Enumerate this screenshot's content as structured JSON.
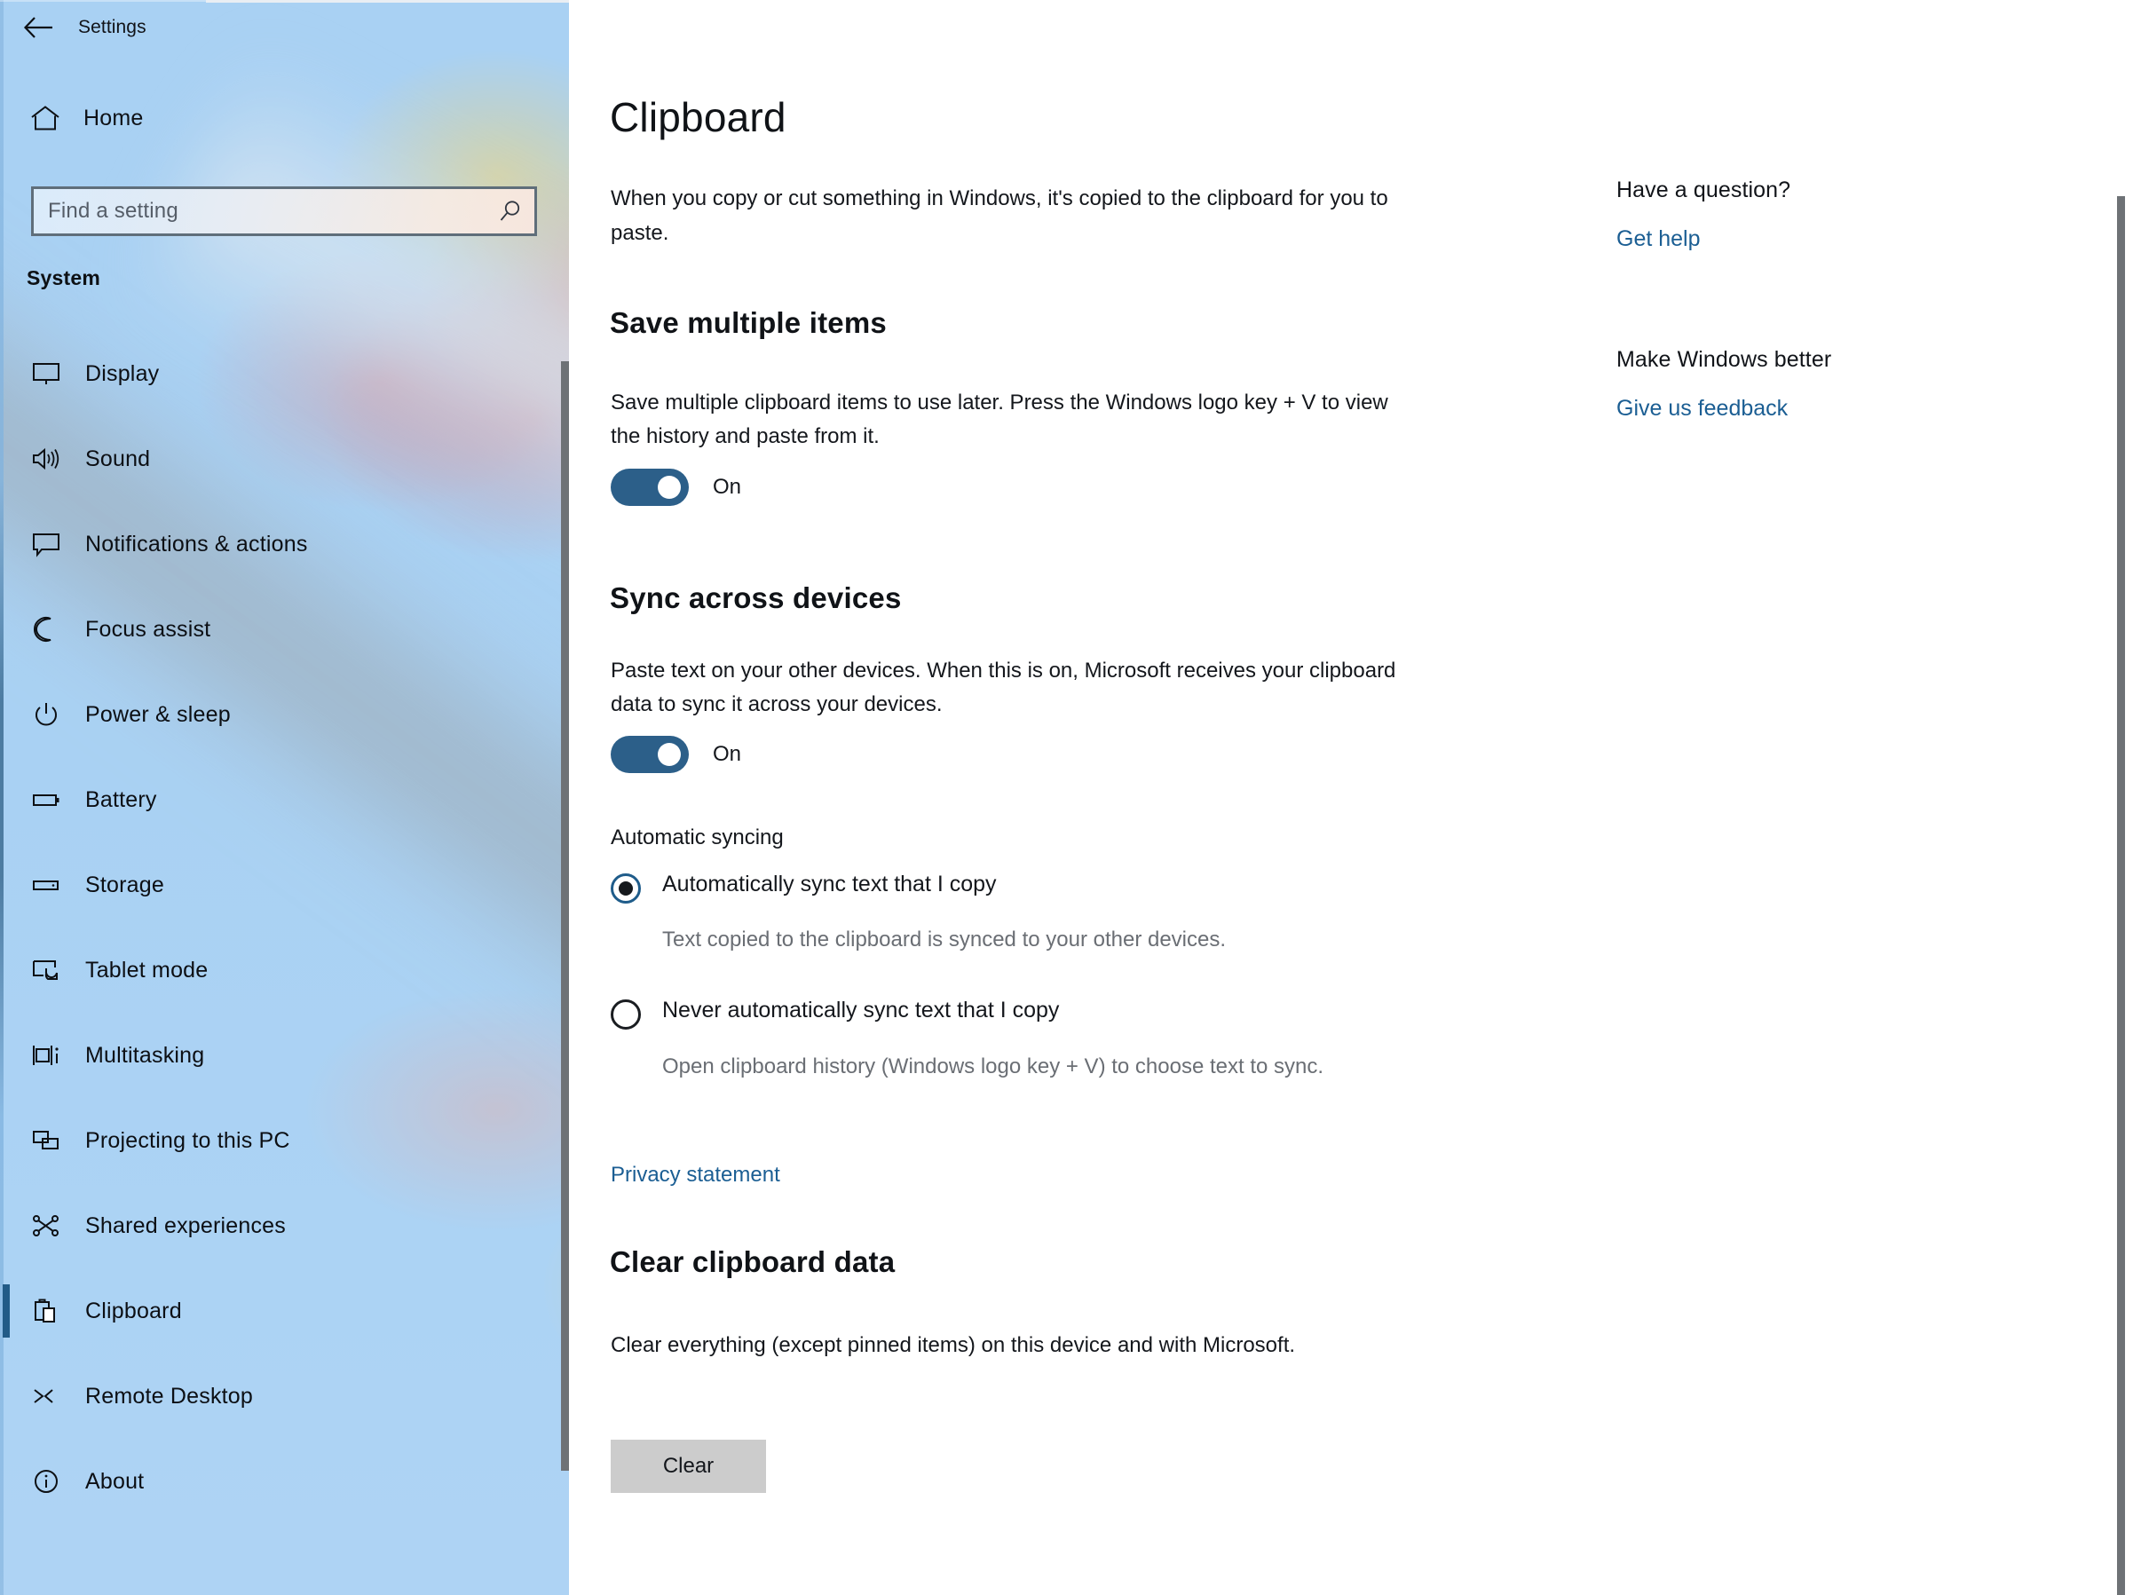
{
  "window": {
    "titlebar_back_icon": "back-arrow-icon",
    "app_title": "Settings"
  },
  "sidebar": {
    "home_label": "Home",
    "home_icon": "home-icon",
    "search": {
      "placeholder": "Find a setting",
      "value": "",
      "icon": "search-icon"
    },
    "section_label": "System",
    "selected_item": "Clipboard",
    "items": [
      {
        "label": "Display",
        "icon": "monitor-icon",
        "selected": false
      },
      {
        "label": "Sound",
        "icon": "speaker-icon",
        "selected": false
      },
      {
        "label": "Notifications & actions",
        "icon": "chat-bubble-icon",
        "selected": false
      },
      {
        "label": "Focus assist",
        "icon": "moon-icon",
        "selected": false
      },
      {
        "label": "Power & sleep",
        "icon": "power-icon",
        "selected": false
      },
      {
        "label": "Battery",
        "icon": "battery-icon",
        "selected": false
      },
      {
        "label": "Storage",
        "icon": "storage-icon",
        "selected": false
      },
      {
        "label": "Tablet mode",
        "icon": "tablet-touch-icon",
        "selected": false
      },
      {
        "label": "Multitasking",
        "icon": "multitasking-icon",
        "selected": false
      },
      {
        "label": "Projecting to this PC",
        "icon": "projecting-icon",
        "selected": false
      },
      {
        "label": "Shared experiences",
        "icon": "share-nodes-icon",
        "selected": false
      },
      {
        "label": "Clipboard",
        "icon": "clipboard-icon",
        "selected": true
      },
      {
        "label": "Remote Desktop",
        "icon": "remote-desktop-icon",
        "selected": false
      },
      {
        "label": "About",
        "icon": "info-circle-icon",
        "selected": false
      }
    ]
  },
  "page": {
    "title": "Clipboard",
    "intro": "When you copy or cut something in Windows, it's copied to the clipboard for you to paste.",
    "save_multiple": {
      "heading": "Save multiple items",
      "description": "Save multiple clipboard items to use later. Press the Windows logo key + V to view the history and paste from it.",
      "toggle_state": "On"
    },
    "sync_across_devices": {
      "heading": "Sync across devices",
      "description": "Paste text on your other devices. When this is on, Microsoft receives your clipboard data to sync it across your devices.",
      "toggle_state": "On",
      "automatic_syncing_label": "Automatic syncing",
      "options": [
        {
          "label": "Automatically sync text that I copy",
          "help": "Text copied to the clipboard is synced to your other devices.",
          "checked": true
        },
        {
          "label": "Never automatically sync text that I copy",
          "help": "Open clipboard history (Windows logo key + V) to choose text to sync.",
          "checked": false
        }
      ],
      "privacy_link": "Privacy statement"
    },
    "clear_clipboard": {
      "heading": "Clear clipboard data",
      "description": "Clear everything (except pinned items) on this device and with Microsoft.",
      "button_label": "Clear"
    }
  },
  "help_panel": {
    "question_heading": "Have a question?",
    "question_link": "Get help",
    "feedback_heading": "Make Windows better",
    "feedback_link": "Give us feedback"
  },
  "colors": {
    "accent_toggle": "#2c5f89",
    "link": "#1b5e93",
    "selection_bar": "#225b87",
    "acrylic_base": "#a9d1f4",
    "button_face": "#cccccc",
    "scrollbar": "#6e7276"
  }
}
